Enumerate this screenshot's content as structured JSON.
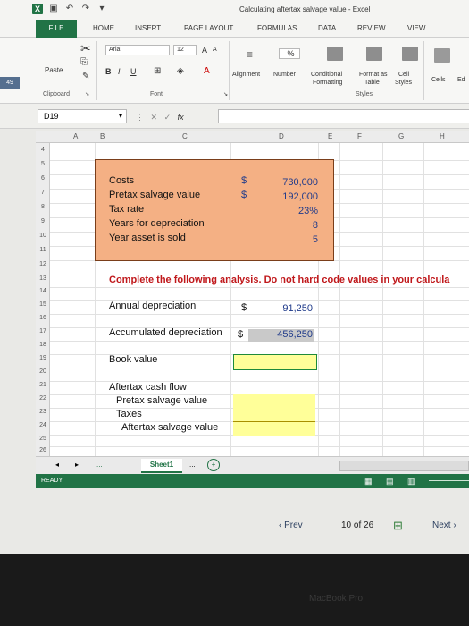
{
  "window": {
    "title": "Calculating aftertax salvage value - Excel"
  },
  "tabs": [
    "FILE",
    "HOME",
    "INSERT",
    "PAGE LAYOUT",
    "FORMULAS",
    "DATA",
    "REVIEW",
    "VIEW"
  ],
  "ribbon": {
    "paste": "Paste",
    "clipboard": "Clipboard",
    "font_name": "Arial",
    "font_size": "12",
    "grow": "A",
    "shrink": "A",
    "bold": "B",
    "italic": "I",
    "underline": "U",
    "font_group": "Font",
    "alignment": "Alignment",
    "number": "Number",
    "percent": "%",
    "conditional": "Conditional",
    "formatting": "Formatting",
    "format_as": "Format as",
    "table": "Table",
    "cell": "Cell",
    "styles_btn": "Styles",
    "styles_group": "Styles",
    "cells": "Cells",
    "edit": "Ed"
  },
  "side_number": "49",
  "formula_bar": {
    "name_box": "D19",
    "fx": "fx"
  },
  "columns": [
    "A",
    "B",
    "C",
    "D",
    "E",
    "F",
    "G",
    "H"
  ],
  "rows": [
    "4",
    "5",
    "6",
    "7",
    "8",
    "9",
    "10",
    "11",
    "12",
    "13",
    "14",
    "15",
    "16",
    "17",
    "18",
    "19",
    "20",
    "21",
    "22",
    "23",
    "24",
    "25",
    "26"
  ],
  "costs_table": {
    "labels": [
      "Costs",
      "Pretax salvage value",
      "Tax rate",
      "Years for depreciation",
      "Year asset is sold"
    ],
    "currency": [
      "$",
      "$"
    ],
    "values": [
      "730,000",
      "192,000",
      "23%",
      "8",
      "5"
    ]
  },
  "instruction": "Complete the following analysis. Do not hard code values in your calcula",
  "analysis": {
    "annual_dep_label": "Annual depreciation",
    "annual_dep_currency": "$",
    "annual_dep_value": "91,250",
    "accum_dep_label": "Accumulated depreciation",
    "accum_dep_currency": "$",
    "accum_dep_value": "456,250",
    "book_value_label": "Book value",
    "aftertax_cf_label": "Aftertax cash flow",
    "pretax_salvage_label": "Pretax salvage value",
    "taxes_label": "Taxes",
    "aftertax_salvage_label": "Aftertax salvage value"
  },
  "sheet": {
    "ellipsis": "...",
    "tab": "Sheet1",
    "ellipsis2": "..."
  },
  "status": "READY",
  "pagination": {
    "prev": "Prev",
    "counter": "10 of 26",
    "next": "Next"
  },
  "device_brand": "MacBook Pro"
}
